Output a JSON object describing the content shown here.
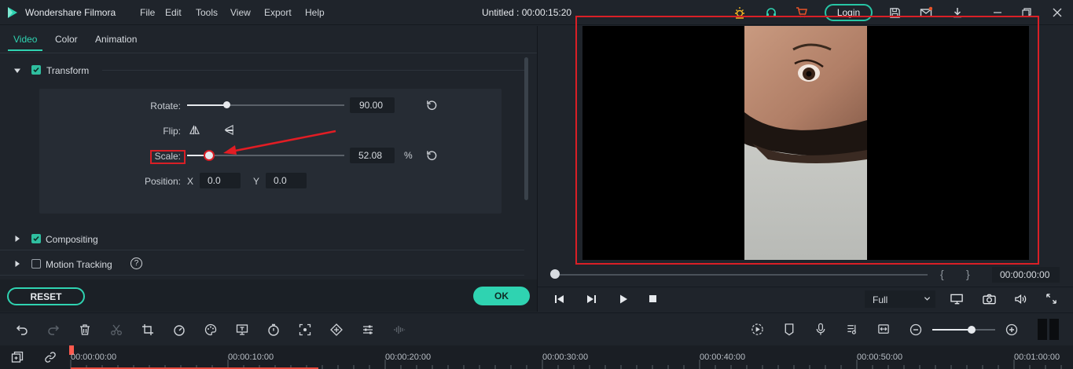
{
  "app": {
    "name": "Wondershare Filmora",
    "project_title": "Untitled : 00:00:15:20",
    "menu": [
      "File",
      "Edit",
      "Tools",
      "View",
      "Export",
      "Help"
    ],
    "login_label": "Login",
    "accent_color": "#2fd3b1",
    "highlight_color": "#d91f26"
  },
  "panel": {
    "tabs": [
      {
        "label": "Video",
        "active": true
      },
      {
        "label": "Color",
        "active": false
      },
      {
        "label": "Animation",
        "active": false
      }
    ],
    "transform": {
      "label": "Transform",
      "checked": true,
      "expanded": true,
      "rotate_label": "Rotate:",
      "rotate_value": "90.00",
      "rotate_fraction": 0.25,
      "flip_label": "Flip:",
      "scale_label": "Scale:",
      "scale_value": "52.08",
      "scale_unit": "%",
      "scale_fraction": 0.14,
      "position_label": "Position:",
      "x_label": "X",
      "x_value": "0.0",
      "y_label": "Y",
      "y_value": "0.0"
    },
    "compositing": {
      "label": "Compositing",
      "checked": true
    },
    "motion_tracking": {
      "label": "Motion Tracking",
      "checked": false
    },
    "reset_label": "RESET",
    "ok_label": "OK"
  },
  "player": {
    "timecode": "00:00:00:00",
    "quality": "Full",
    "brackets_open": "{",
    "brackets_close": "}"
  },
  "timeline": {
    "ruler": [
      "00:00:00:00",
      "00:00:10:00",
      "00:00:20:00",
      "00:00:30:00",
      "00:00:40:00",
      "00:00:50:00",
      "00:01:00:00"
    ],
    "zoom_fraction": 0.62
  }
}
